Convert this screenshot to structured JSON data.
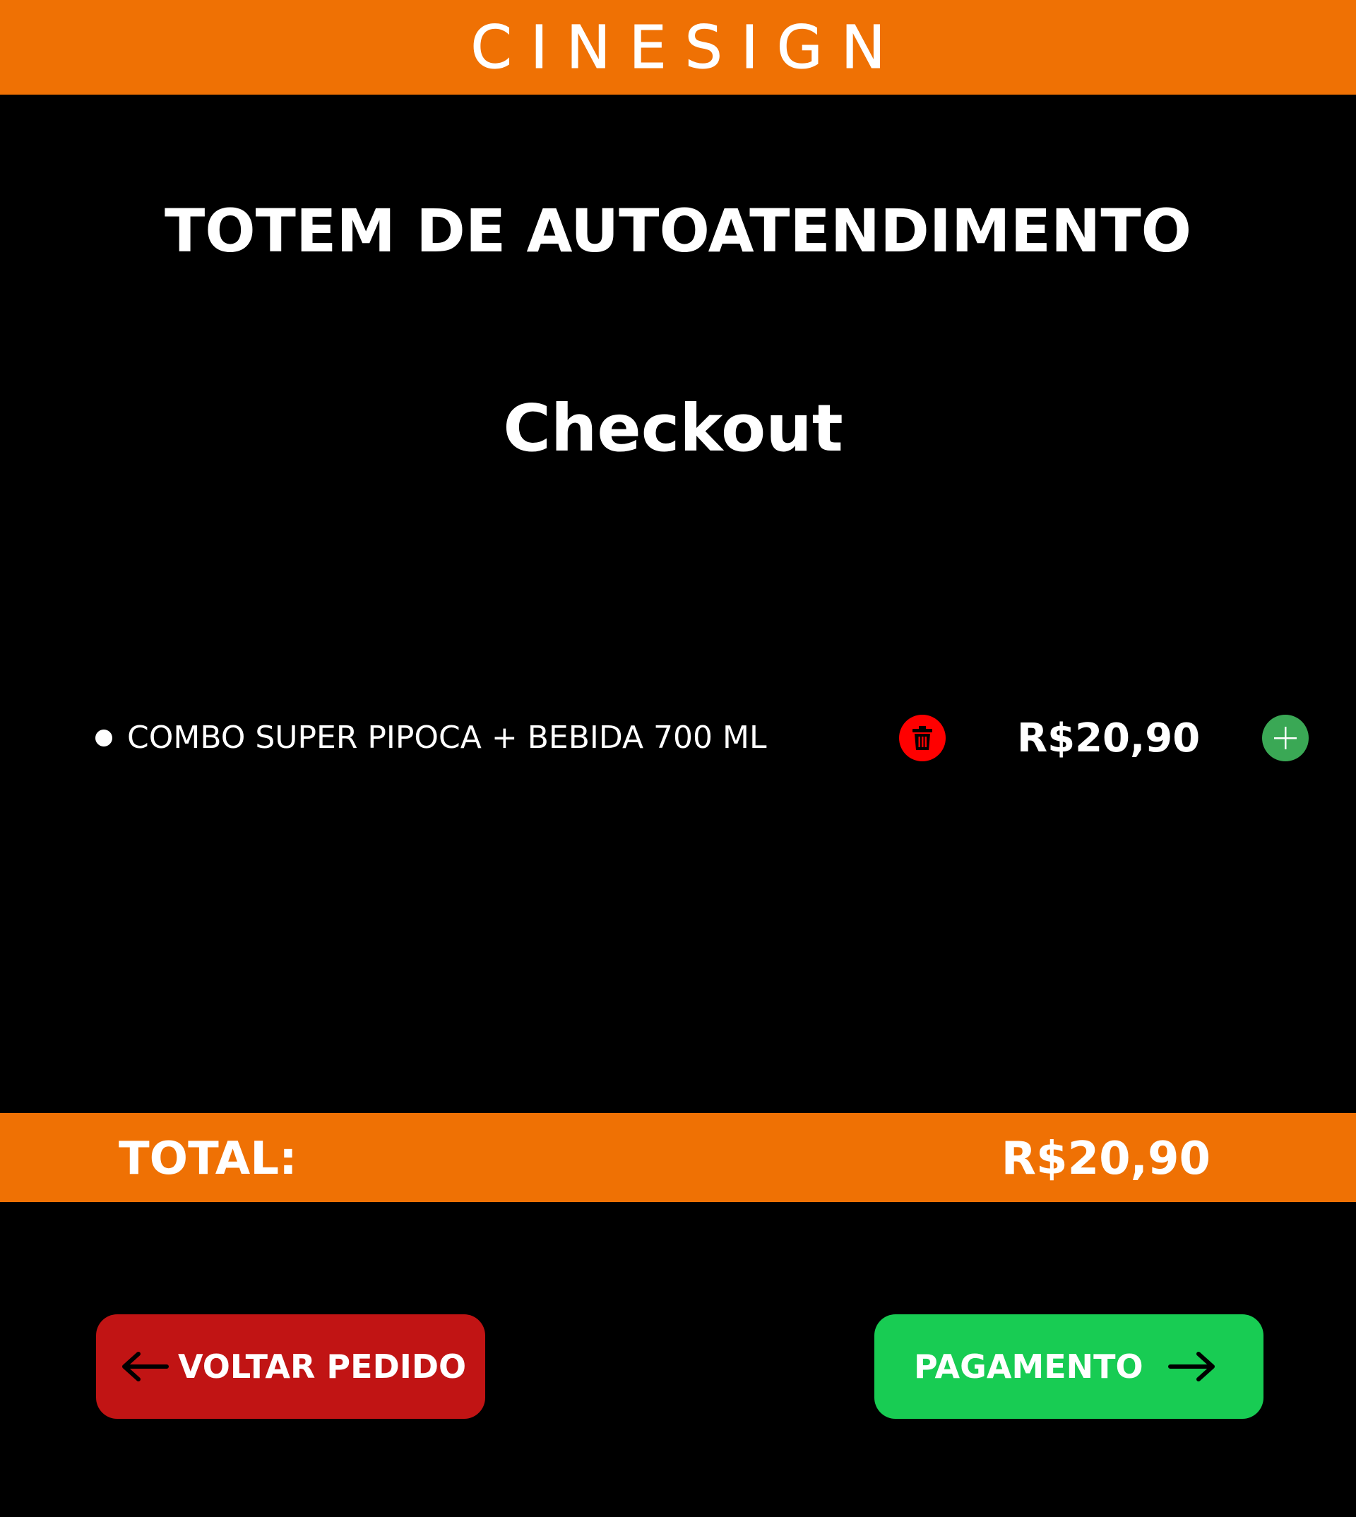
{
  "header": {
    "brand": "CINESIGN"
  },
  "page": {
    "title": "TOTEM DE AUTOATENDIMENTO",
    "subtitle": "Checkout"
  },
  "cart": {
    "items": [
      {
        "name": "COMBO SUPER PIPOCA + BEBIDA 700 ML",
        "price": "R$20,90",
        "remove_icon": "trash-icon",
        "add_icon": "plus-icon"
      }
    ]
  },
  "total": {
    "label": "TOTAL:",
    "value": "R$20,90"
  },
  "actions": {
    "back_label": "VOLTAR PEDIDO",
    "back_icon": "arrow-left-icon",
    "pay_label": "PAGAMENTO",
    "pay_icon": "arrow-right-icon"
  },
  "colors": {
    "accent_orange": "#ef7104",
    "background": "#000000",
    "remove_red": "#ff0000",
    "add_green": "#3aa855",
    "back_button": "#c11414",
    "pay_button": "#18cc53"
  }
}
